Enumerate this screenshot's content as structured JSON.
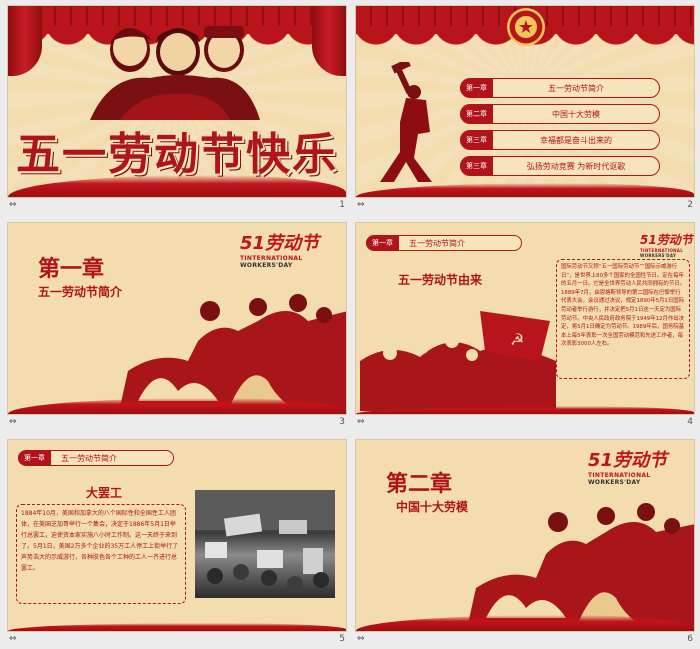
{
  "footer_symbol": "⇔",
  "slides": [
    {
      "num": "1",
      "title": "五一劳动节快乐"
    },
    {
      "num": "2",
      "menu": [
        {
          "chap": "第一章",
          "text": "五一劳动节简介"
        },
        {
          "chap": "第二章",
          "text": "中国十大劳模"
        },
        {
          "chap": "第三章",
          "text": "幸福都是奋斗出来的"
        },
        {
          "chap": "第三章",
          "text": "弘扬劳动竞赛 为新时代讴歌"
        }
      ]
    },
    {
      "num": "3",
      "chapter": "第一章",
      "subtitle": "五一劳动节简介",
      "logo": {
        "main": "51劳动节",
        "sub1": "TINTERNATIONAL",
        "sub2": "WORKERS'DAY"
      }
    },
    {
      "num": "4",
      "tag": {
        "chap": "第一章",
        "text": "五一劳动节简介"
      },
      "heading": "五一劳动节由来",
      "logo": {
        "main": "51劳动节",
        "sub1": "TINTERNATIONAL",
        "sub2": "WORKERS'DAY"
      },
      "body": "国际劳动节又称“五一国际劳动节”“国际示威游行日”，是世界上80多个国家的全国性节日。定在每年的五月一日。它是全世界劳动人民共同拥有的节日。1889年7月，由恩格斯领导的第二国际在巴黎举行代表大会。会议通过决议，规定1890年5月1日国际劳动者举行游行，并决定把5月1日这一天定为国际劳动节。中央人民政府政务院于1949年12月作出决定，将5月1日确定为劳动节。1989年后，国务院基本上每5年表彰一次全国劳动模范和先进工作者，每次表彰3000人左右。"
    },
    {
      "num": "5",
      "tag": {
        "chap": "第一章",
        "text": "五一劳动节简介"
      },
      "heading": "大罢工",
      "body": "1884年10月，美国和加拿大的八个国际性和全国性工人团体，在美国芝加哥举行一个集会，决定于1886年5月1日举行总罢工，迫使资本家实施八小时工作制。这一天终于来到了。5月1日，美国2万多个企业的35万工人停工上街举行了声势浩大的示威游行，各种肤色各个工种的工人一齐进行总罢工。"
    },
    {
      "num": "6",
      "chapter": "第二章",
      "subtitle": "中国十大劳模",
      "logo": {
        "main": "51劳动节",
        "sub1": "TINTERNATIONAL",
        "sub2": "WORKERS'DAY"
      }
    }
  ],
  "colors": {
    "red": "#b0141a",
    "paper": "#f3dcae"
  }
}
